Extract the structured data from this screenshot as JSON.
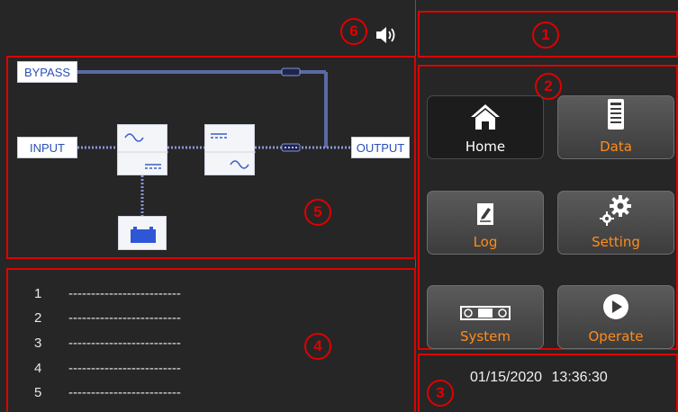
{
  "callouts": [
    "1",
    "2",
    "3",
    "4",
    "5",
    "6"
  ],
  "header": {
    "speaker_icon": "speaker-icon"
  },
  "diagram": {
    "bypass_label": "BYPASS",
    "input_label": "INPUT",
    "output_label": "OUTPUT",
    "battery_icon": "battery-icon",
    "rectifier_icon": "rectifier-icon",
    "inverter_icon": "inverter-icon"
  },
  "menu": {
    "buttons": [
      {
        "label": "Home",
        "icon": "home-icon",
        "active": true
      },
      {
        "label": "Data",
        "icon": "data-icon",
        "active": false
      },
      {
        "label": "Log",
        "icon": "log-icon",
        "active": false
      },
      {
        "label": "Setting",
        "icon": "gear-icon",
        "active": false
      },
      {
        "label": "System",
        "icon": "system-icon",
        "active": false
      },
      {
        "label": "Operate",
        "icon": "play-icon",
        "active": false
      }
    ]
  },
  "log": {
    "rows": [
      {
        "num": "1",
        "text": "-------------------------"
      },
      {
        "num": "2",
        "text": "-------------------------"
      },
      {
        "num": "3",
        "text": "-------------------------"
      },
      {
        "num": "4",
        "text": "-------------------------"
      },
      {
        "num": "5",
        "text": "-------------------------"
      }
    ]
  },
  "status": {
    "datetime": "01/15/2020  13:36:30"
  },
  "colors": {
    "annotation": "#e00000",
    "accent": "#ff8c1a",
    "line": "#5b6aa8"
  }
}
